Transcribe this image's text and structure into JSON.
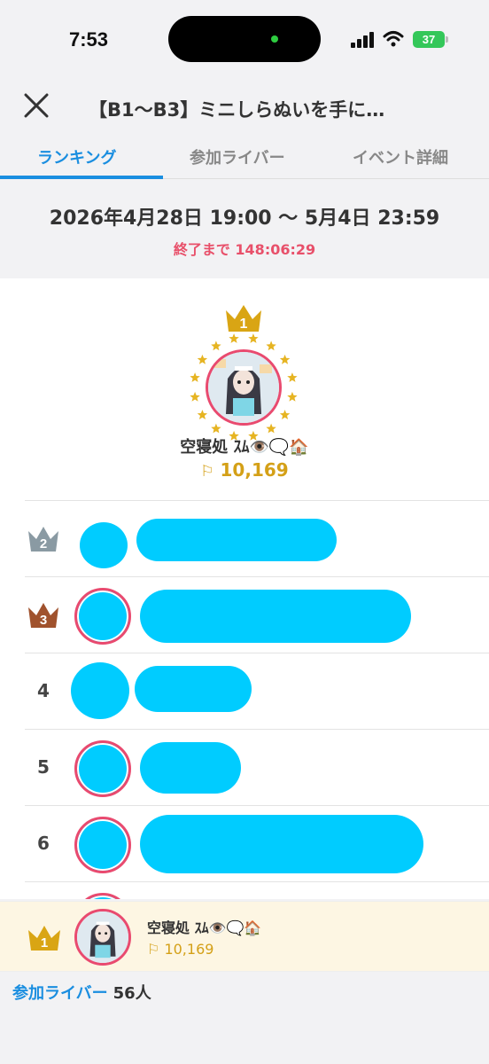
{
  "status_bar": {
    "time": "7:53",
    "battery": "37"
  },
  "header": {
    "title": "【B1〜B3】ミニしらぬいを手に…"
  },
  "tabs": [
    {
      "label": "ランキング",
      "active": true
    },
    {
      "label": "参加ライバー",
      "active": false
    },
    {
      "label": "イベント詳細",
      "active": false
    }
  ],
  "event": {
    "period": "2026年4月28日 19:00 〜 5月4日 23:59",
    "countdown": "終了まで 148:06:29"
  },
  "ranking": {
    "top": {
      "rank": "1",
      "name": "空寝処 ｽﾑ👁️🗨️🏠",
      "score": "10,169"
    },
    "rows": [
      {
        "rank": "2"
      },
      {
        "rank": "3"
      },
      {
        "rank": "4"
      },
      {
        "rank": "5"
      },
      {
        "rank": "6"
      }
    ]
  },
  "my_rank": {
    "rank": "1",
    "name": "空寝処 ｽﾑ👁️🗨️🏠",
    "score": "10,169"
  },
  "footer": {
    "participants_label": "参加ライバー",
    "participants_count": "56人"
  },
  "colors": {
    "accent": "#1a8ee0",
    "countdown": "#e8506a",
    "gold": "#d4a017",
    "silver": "#8a9aa3",
    "bronze": "#a0522d",
    "redaction": "#00ccff"
  }
}
